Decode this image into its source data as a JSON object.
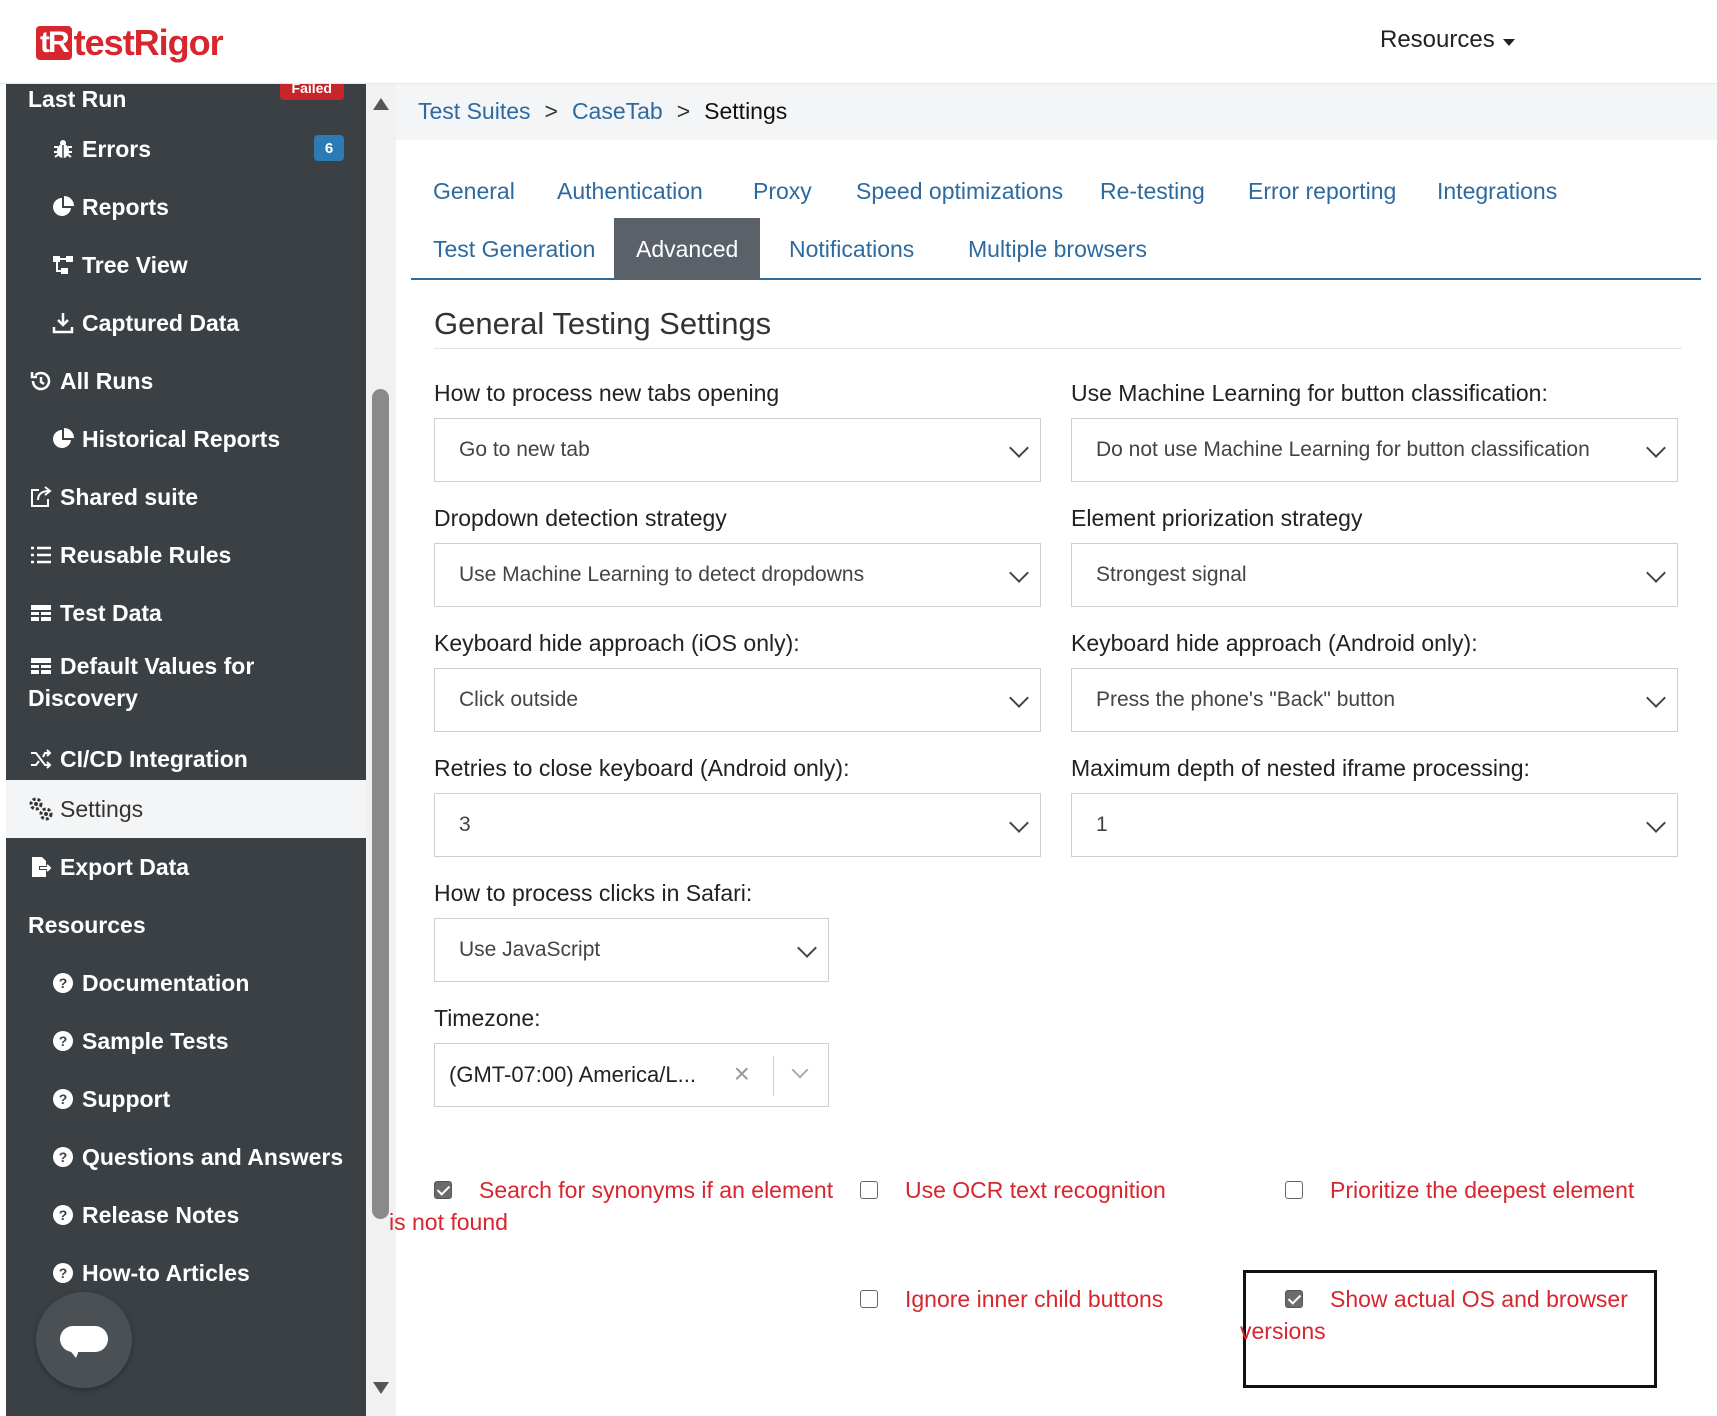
{
  "header": {
    "logo_mark": "tR",
    "logo_text": "testRigor",
    "resources_label": "Resources"
  },
  "sidebar": {
    "last_run": "Last Run",
    "failed_badge": "Failed",
    "errors": "Errors",
    "errors_count": "6",
    "reports": "Reports",
    "tree_view": "Tree View",
    "captured_data": "Captured Data",
    "all_runs": "All Runs",
    "historical_reports": "Historical Reports",
    "shared_suite": "Shared suite",
    "reusable_rules": "Reusable Rules",
    "test_data": "Test Data",
    "default_values_1": "Default Values for",
    "default_values_2": "Discovery",
    "cicd": "CI/CD Integration",
    "settings": "Settings",
    "export_data": "Export Data",
    "resources": "Resources",
    "documentation": "Documentation",
    "sample_tests": "Sample Tests",
    "support": "Support",
    "qa": "Questions and Answers",
    "release_notes": "Release Notes",
    "howto": "How-to Articles"
  },
  "breadcrumb": {
    "test_suites": "Test Suites",
    "sep": ">",
    "suite": "CaseTab",
    "current": "Settings"
  },
  "tabs": {
    "general": "General",
    "authentication": "Authentication",
    "proxy": "Proxy",
    "speed": "Speed optimizations",
    "retesting": "Re-testing",
    "error_reporting": "Error reporting",
    "integrations": "Integrations",
    "test_generation": "Test Generation",
    "advanced": "Advanced",
    "notifications": "Notifications",
    "multiple_browsers": "Multiple browsers"
  },
  "form": {
    "title": "General Testing Settings",
    "new_tabs_label": "How to process new tabs opening",
    "new_tabs_value": "Go to new tab",
    "ml_button_label": "Use Machine Learning for button classification:",
    "ml_button_value": "Do not use Machine Learning for button classification",
    "dropdown_label": "Dropdown detection strategy",
    "dropdown_value": "Use Machine Learning to detect dropdowns",
    "element_label": "Element priorization strategy",
    "element_value": "Strongest signal",
    "kb_ios_label": "Keyboard hide approach (iOS only):",
    "kb_ios_value": "Click outside",
    "kb_android_label": "Keyboard hide approach (Android only):",
    "kb_android_value": "Press the phone's \"Back\" button",
    "retries_label": "Retries to close keyboard (Android only):",
    "retries_value": "3",
    "iframe_label": "Maximum depth of nested iframe processing:",
    "iframe_value": "1",
    "safari_label": "How to process clicks in Safari:",
    "safari_value": "Use JavaScript",
    "timezone_label": "Timezone:",
    "timezone_value": "(GMT-07:00) America/L...",
    "timezone_clear": "×"
  },
  "checkboxes": {
    "synonyms_1": "Search for synonyms if an element",
    "synonyms_2": "is not found",
    "synonyms_checked": true,
    "ocr": "Use OCR text recognition",
    "ocr_checked": false,
    "deepest": "Prioritize the deepest element",
    "deepest_checked": false,
    "ignore_inner": "Ignore inner child buttons",
    "ignore_inner_checked": false,
    "show_os_1": "Show actual OS and browser",
    "show_os_2": "versions",
    "show_os_checked": true
  },
  "colors": {
    "brand_red": "#d7262e",
    "link_blue": "#2d6a9f",
    "sidebar_bg": "#3a4044",
    "active_tab_bg": "#5a6168"
  }
}
